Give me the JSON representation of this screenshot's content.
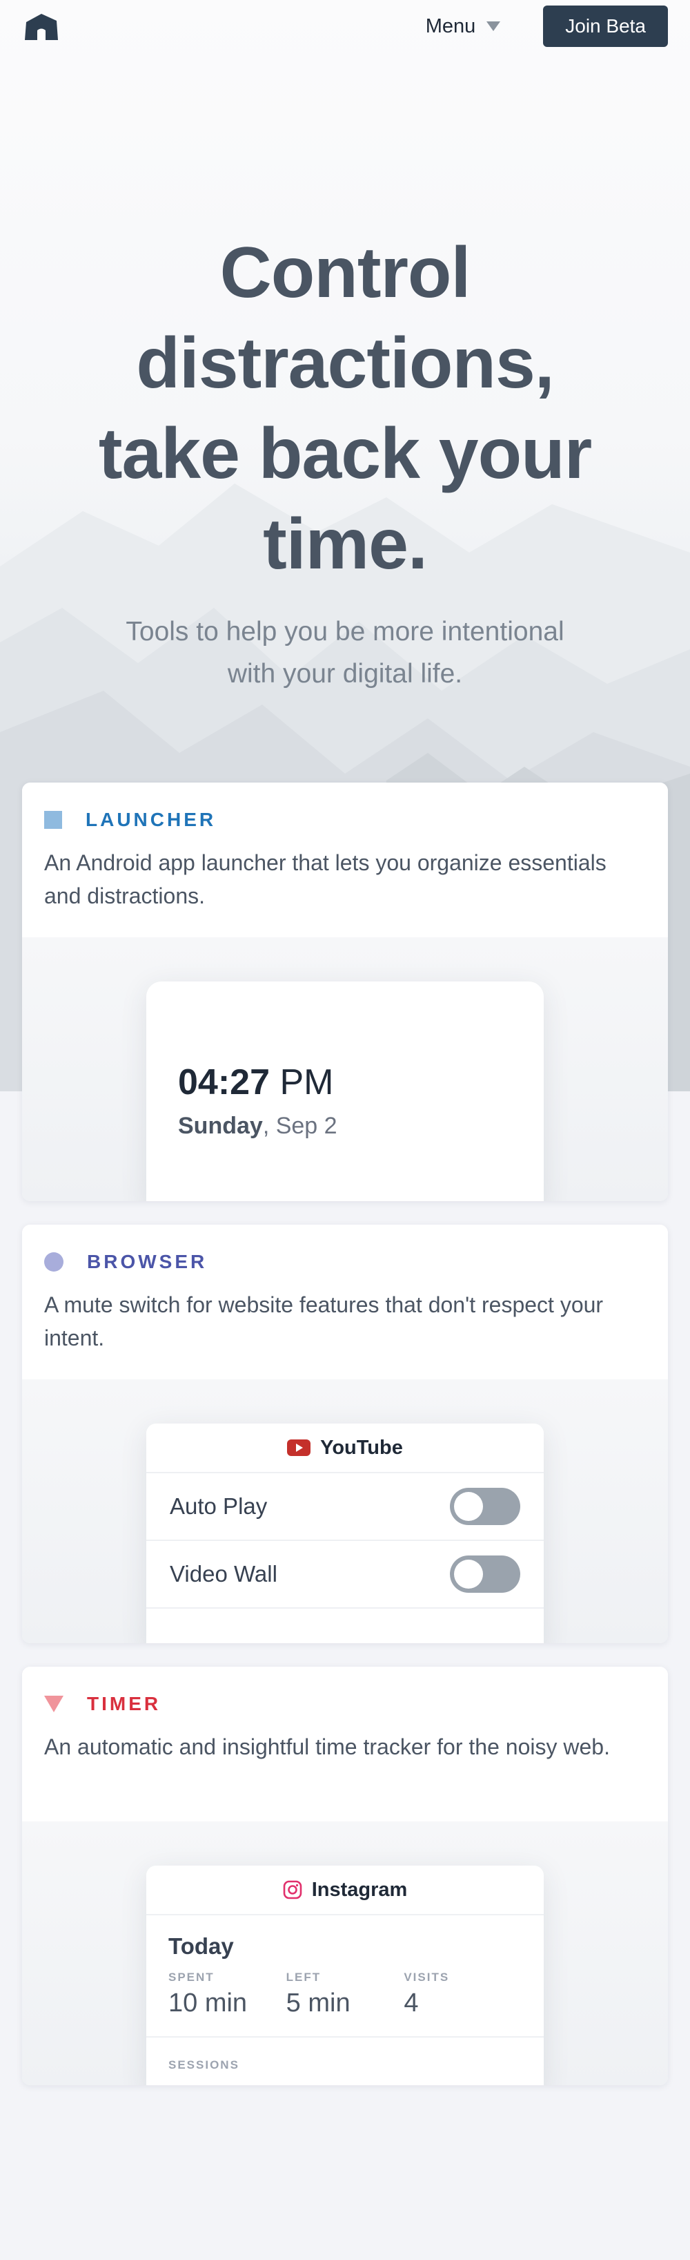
{
  "nav": {
    "logo_icon": "cabin-logo-icon",
    "menu_label": "Menu",
    "menu_icon": "caret-down-icon",
    "cta_label": "Join Beta"
  },
  "hero": {
    "title_lines": [
      "Control",
      "distractions,",
      "take back your",
      "time."
    ],
    "subtitle_lines": [
      "Tools to help you be more intentional",
      "with your digital life."
    ]
  },
  "products": {
    "launcher": {
      "label": "LAUNCHER",
      "icon": "square-icon",
      "color": "#1f74b8",
      "icon_color": "#8fbadf",
      "description": "An Android app launcher that lets you organize essentials and distractions.",
      "time_hm": "04:27",
      "time_ampm": "PM",
      "day": "Sunday",
      "date": ", Sep 2"
    },
    "browser": {
      "label": "BROWSER",
      "icon": "circle-icon",
      "color": "#4b55a8",
      "icon_color": "#a8addb",
      "description": "A mute switch for website features that don't respect your intent.",
      "site_name": "YouTube",
      "site_icon": "youtube-icon",
      "toggles": [
        {
          "label": "Auto Play",
          "state": "off"
        },
        {
          "label": "Video Wall",
          "state": "off"
        }
      ]
    },
    "timer": {
      "label": "TIMER",
      "icon": "triangle-down-icon",
      "color": "#d9303e",
      "icon_color": "#f0949b",
      "description": "An automatic and insightful time tracker for the noisy web.",
      "site_name": "Instagram",
      "site_icon": "instagram-icon",
      "period": "Today",
      "stats": [
        {
          "label": "SPENT",
          "value": "10 min"
        },
        {
          "label": "LEFT",
          "value": "5 min"
        },
        {
          "label": "VISITS",
          "value": "4"
        }
      ],
      "sessions_label": "SESSIONS"
    }
  }
}
